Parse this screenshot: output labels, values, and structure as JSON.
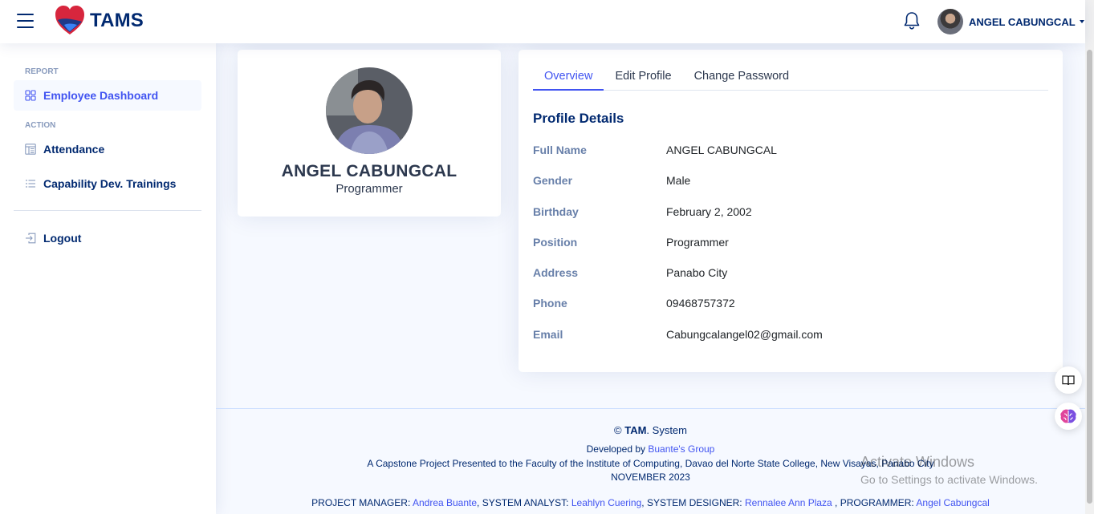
{
  "app": {
    "logo_text": "TAMS"
  },
  "header": {
    "user_name": "ANGEL CABUNGCAL"
  },
  "sidebar": {
    "headings": [
      "REPORT",
      "ACTION"
    ],
    "items": [
      {
        "label": "Employee Dashboard",
        "icon": "grid-icon",
        "active": true
      },
      {
        "label": "Attendance",
        "icon": "layout-text-window-icon",
        "active": false
      },
      {
        "label": "Capability Dev. Trainings",
        "icon": "list-icon",
        "active": false
      },
      {
        "label": "Logout",
        "icon": "box-arrow-in-left-icon",
        "active": false
      }
    ]
  },
  "profile_card": {
    "name": "ANGEL CABUNGCAL",
    "role": "Programmer"
  },
  "tabs": [
    {
      "label": "Overview",
      "active": true
    },
    {
      "label": "Edit Profile",
      "active": false
    },
    {
      "label": "Change Password",
      "active": false
    }
  ],
  "details": {
    "title": "Profile Details",
    "rows": [
      {
        "label": "Full Name",
        "value": "ANGEL CABUNGCAL"
      },
      {
        "label": "Gender",
        "value": "Male"
      },
      {
        "label": "Birthday",
        "value": "February 2, 2002"
      },
      {
        "label": "Position",
        "value": "Programmer"
      },
      {
        "label": "Address",
        "value": "Panabo City"
      },
      {
        "label": "Phone",
        "value": "09468757372"
      },
      {
        "label": "Email",
        "value": "Cabungcalangel02@gmail.com"
      }
    ]
  },
  "footer": {
    "copyright_symbol": "©",
    "brand": "TAM",
    "brand_suffix": ". System",
    "developed_by_prefix": "Developed by ",
    "developer": "Buante's Group",
    "capstone": "A Capstone Project Presented to the Faculty of the Institute of Computing, Davao del Norte State College, New Visayas, Panabo City",
    "date": "NOVEMBER 2023",
    "credits": [
      {
        "role": "PROJECT MANAGER: ",
        "name": "Andrea Buante",
        "sep": ", "
      },
      {
        "role": "SYSTEM ANALYST: ",
        "name": "Leahlyn Cuering",
        "sep": ", "
      },
      {
        "role": "SYSTEM DESIGNER: ",
        "name": "Rennalee Ann Plaza",
        "sep": " , "
      },
      {
        "role": "PROGRAMMER: ",
        "name": "Angel Cabungcal",
        "sep": ""
      }
    ]
  },
  "watermark": {
    "line1": "Activate Windows",
    "line2": "Go to Settings to activate Windows."
  },
  "colors": {
    "primary": "#4154f1",
    "navy": "#012970",
    "background": "#f6f9ff"
  }
}
